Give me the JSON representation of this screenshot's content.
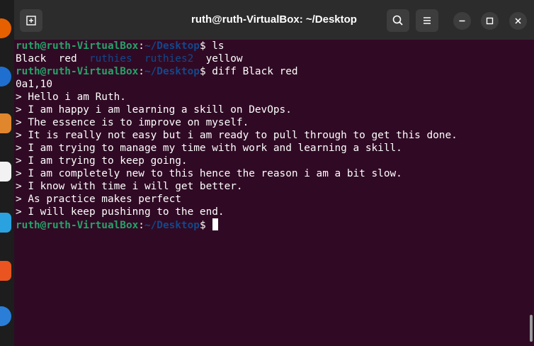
{
  "window": {
    "title": "ruth@ruth-VirtualBox: ~/Desktop",
    "buttons": [
      "new-tab-icon",
      "search-icon",
      "menu-icon",
      "minimize-icon",
      "maximize-icon",
      "close-icon"
    ]
  },
  "prompt": {
    "user": "ruth@ruth-VirtualBox",
    "sep": ":",
    "path": "~/Desktop",
    "symbol": "$"
  },
  "terminal": {
    "cmd1": " ls",
    "ls_output": {
      "f1": "Black",
      "f2": "red",
      "d1": "ruthies",
      "d2": "ruthies2",
      "f3": "yellow"
    },
    "cmd2": " diff Black red",
    "diff_lines": [
      "0a1,10",
      "> Hello i am Ruth.",
      "> I am happy i am learning a skill on DevOps.",
      "> The essence is to improve on myself.",
      "> It is really not easy but i am ready to pull through to get this done.",
      "> I am trying to manage my time with work and learning a skill.",
      "> I am trying to keep going.",
      "> I am completely new to this hence the reason i am a bit slow.",
      "> I know with time i will get better.",
      "> As practice makes perfect",
      "> I will keep pushinng to the end."
    ],
    "cmd3": " "
  },
  "colors": {
    "background": "#300a24",
    "user": "#26a269",
    "path": "#12488b",
    "titlebar": "#2c2c2c"
  }
}
